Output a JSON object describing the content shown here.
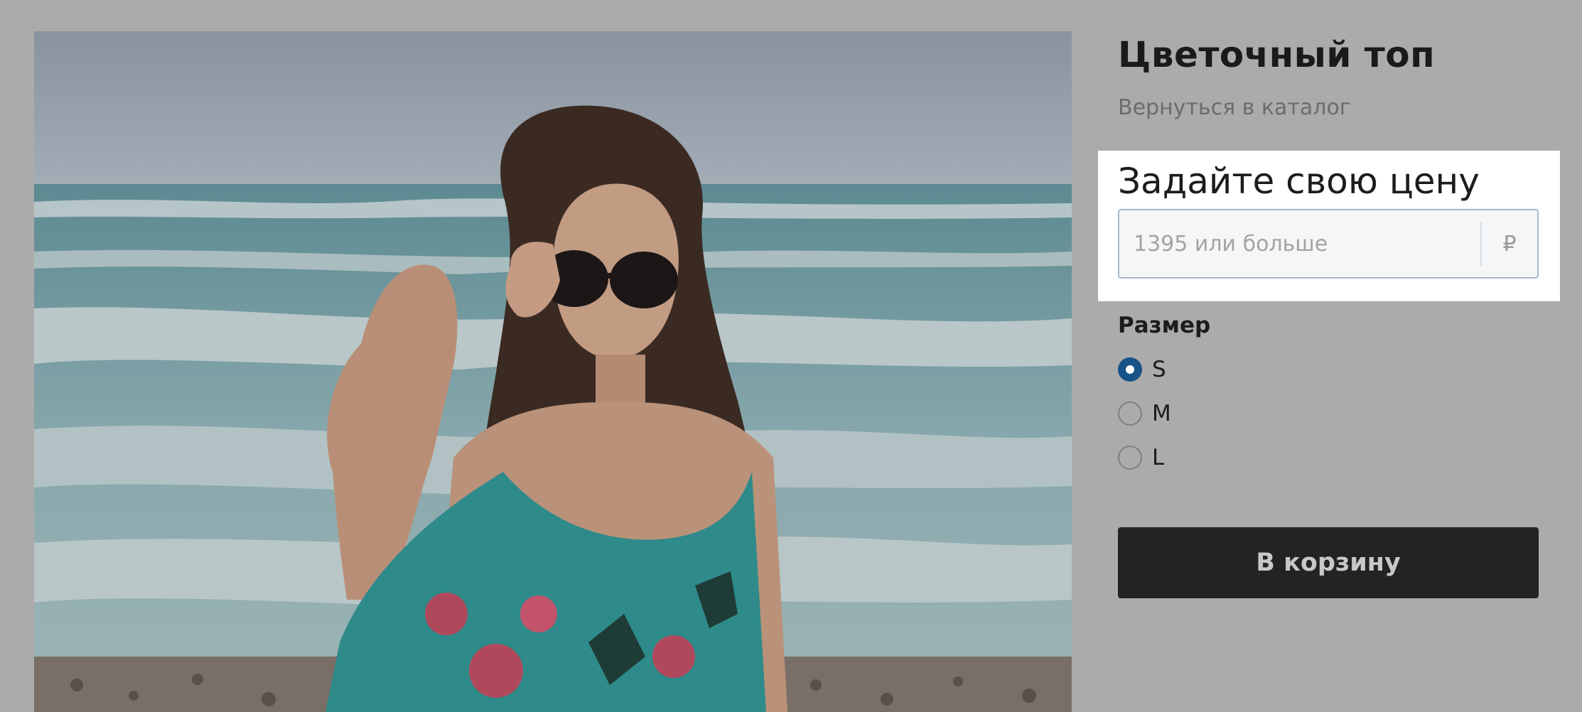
{
  "product": {
    "title": "Цветочный топ",
    "back_link": "Вернуться в каталог",
    "image_alt": "woman-on-beach-photo"
  },
  "price": {
    "heading": "Задайте свою цену",
    "placeholder": "1395 или больше",
    "currency_symbol": "₽"
  },
  "size": {
    "label": "Размер",
    "options": [
      {
        "label": "S",
        "selected": true
      },
      {
        "label": "M",
        "selected": false
      },
      {
        "label": "L",
        "selected": false
      }
    ]
  },
  "cart": {
    "button_label": "В корзину"
  },
  "colors": {
    "overlay": "#ababab",
    "accent_radio": "#175288",
    "button_bg": "#232323"
  }
}
